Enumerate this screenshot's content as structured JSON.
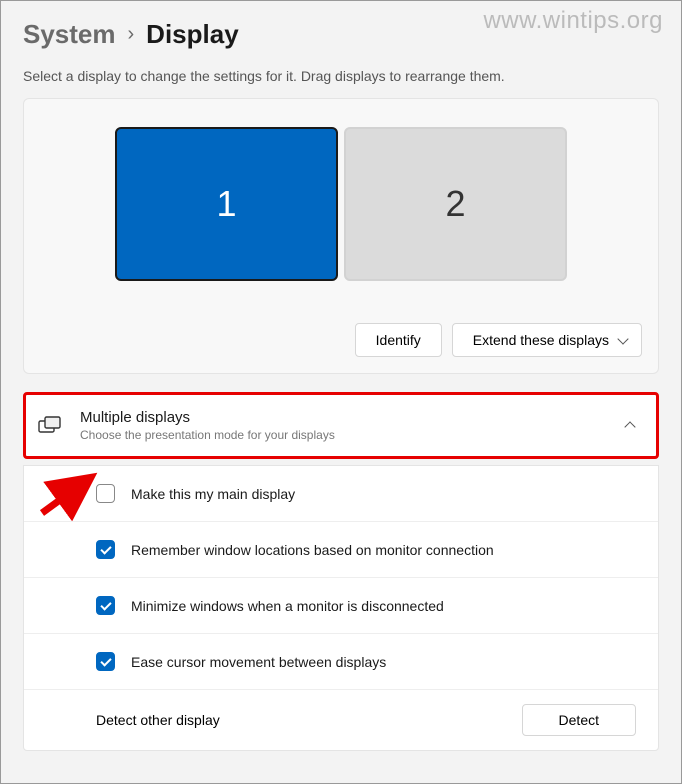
{
  "watermark": "www.wintips.org",
  "breadcrumb": {
    "parent": "System",
    "current": "Display"
  },
  "helper": "Select a display to change the settings for it. Drag displays to rearrange them.",
  "monitors": {
    "m1": "1",
    "m2": "2"
  },
  "buttons": {
    "identify": "Identify",
    "extend": "Extend these displays"
  },
  "section": {
    "title": "Multiple displays",
    "sub": "Choose the presentation mode for your displays"
  },
  "options": {
    "main": "Make this my main display",
    "remember": "Remember window locations based on monitor connection",
    "minimize": "Minimize windows when a monitor is disconnected",
    "ease": "Ease cursor movement between displays",
    "detectLabel": "Detect other display",
    "detectBtn": "Detect"
  }
}
